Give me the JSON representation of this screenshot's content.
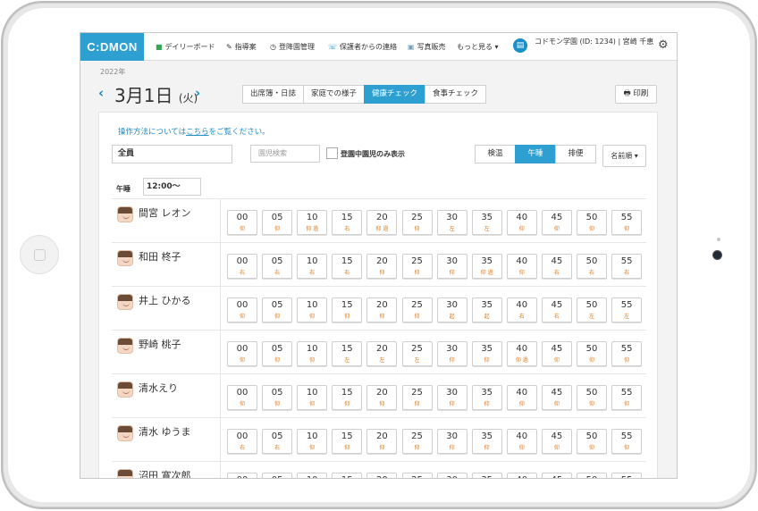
{
  "app": {
    "logo": "C:DMON",
    "nav": [
      {
        "icon": "chart-icon",
        "label": "デイリーボード"
      },
      {
        "icon": "pen-icon",
        "label": "指導案"
      },
      {
        "icon": "clock-icon",
        "label": "登降園管理"
      },
      {
        "icon": "phone-icon",
        "label": "保護者からの連絡"
      },
      {
        "icon": "photo-icon",
        "label": "写真販売"
      },
      {
        "icon": "",
        "label": "もっと見る ▾"
      }
    ],
    "school": "コドモン学園 (ID: 1234) | 宮崎 千恵"
  },
  "date": {
    "year": "2022年",
    "label": "3月1日",
    "dow": "(火)"
  },
  "tabs": [
    "出席簿・日誌",
    "家庭での様子",
    "健康チェック",
    "食事チェック"
  ],
  "active_tab": 2,
  "print_label": "🖶 印刷",
  "help_text": {
    "before": "操作方法については",
    "link": "こちら",
    "after": "をご覧ください。"
  },
  "filter": {
    "group": "全員",
    "search_placeholder": "園児検索",
    "present_only": "登園中園児のみ表示",
    "modes": [
      "検温",
      "午睡",
      "排便"
    ],
    "active_mode": 1,
    "sort": "名前順 ▾"
  },
  "nap": {
    "label": "午睡",
    "time": "12:00〜"
  },
  "minutes": [
    "00",
    "05",
    "10",
    "15",
    "20",
    "25",
    "30",
    "35",
    "40",
    "45",
    "50",
    "55"
  ],
  "children": [
    {
      "name": "間宮 レオン",
      "postures": [
        "仰",
        "仰",
        "仰 過",
        "右",
        "仰 過",
        "仰",
        "左",
        "左",
        "仰",
        "仰",
        "仰",
        "仰"
      ]
    },
    {
      "name": "和田 柊子",
      "postures": [
        "右",
        "右",
        "右",
        "右",
        "仰",
        "仰",
        "仰",
        "仰 過",
        "仰",
        "右",
        "右",
        "右"
      ]
    },
    {
      "name": "井上 ひかる",
      "postures": [
        "仰",
        "仰",
        "仰",
        "仰",
        "仰",
        "仰",
        "起",
        "起",
        "右",
        "右",
        "左",
        "左"
      ]
    },
    {
      "name": "野崎 桃子",
      "postures": [
        "仰",
        "仰",
        "仰",
        "左",
        "左",
        "左",
        "仰",
        "仰",
        "仰 過",
        "仰",
        "仰",
        "仰"
      ]
    },
    {
      "name": "清水えり",
      "postures": [
        "仰",
        "仰",
        "仰",
        "仰",
        "仰",
        "仰",
        "仰",
        "仰",
        "仰",
        "仰",
        "仰",
        "仰"
      ]
    },
    {
      "name": "清水 ゆうま",
      "postures": [
        "右",
        "右",
        "仰",
        "仰",
        "仰",
        "仰",
        "仰",
        "仰",
        "仰",
        "仰",
        "仰",
        "仰"
      ]
    },
    {
      "name": "沼田 寛次郎",
      "postures": [
        "",
        "",
        "",
        "",
        "",
        "",
        "",
        "",
        "",
        "",
        "",
        ""
      ]
    }
  ],
  "fab": "?"
}
